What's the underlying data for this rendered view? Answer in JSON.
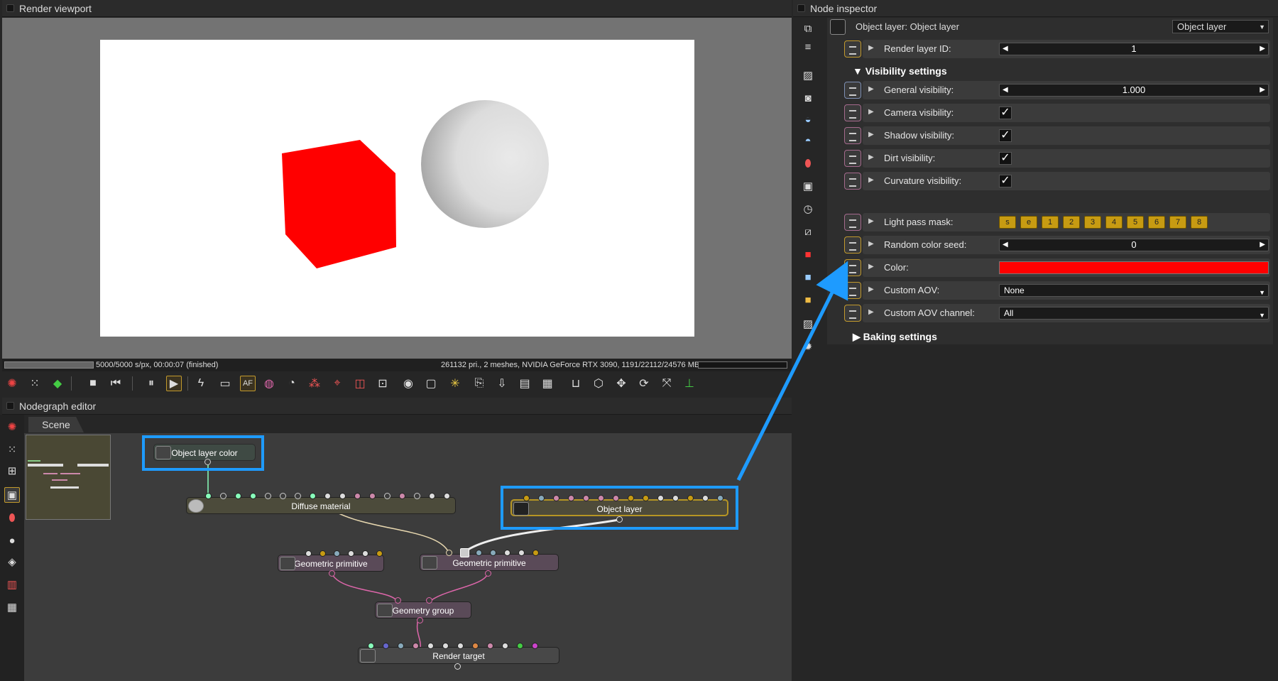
{
  "viewport": {
    "title": "Render viewport",
    "status_left": "5000/5000 s/px, 00:00:07 (finished)",
    "status_right": "261132 pri., 2 meshes, NVIDIA GeForce RTX 3090, 1191/22112/24576 MB",
    "progress": 1.0,
    "toolbar_active_label": "AF",
    "render_colors": {
      "cube": "#ff0000",
      "sphere": "#d8d8d8",
      "background": "#ffffff"
    }
  },
  "nodegraph": {
    "title": "Nodegraph editor",
    "tab": "Scene",
    "nodes": {
      "object_layer_color": "Object layer color",
      "diffuse_material": "Diffuse material",
      "object_layer": "Object layer",
      "geometric_primitive_1": "Geometric primitive",
      "geometric_primitive_2": "Geometric primitive",
      "geometry_group": "Geometry group",
      "render_target": "Render target"
    },
    "highlight_color": "#1e9bff"
  },
  "inspector": {
    "title": "Node inspector",
    "header_label": "Object layer: Object layer",
    "header_dropdown": "Object layer",
    "render_layer_id": {
      "label": "Render layer ID:",
      "value": "1"
    },
    "visibility_section": "Visibility settings",
    "general_visibility": {
      "label": "General visibility:",
      "value": "1.000"
    },
    "camera_visibility": {
      "label": "Camera visibility:",
      "checked": true
    },
    "shadow_visibility": {
      "label": "Shadow visibility:",
      "checked": true
    },
    "dirt_visibility": {
      "label": "Dirt visibility:",
      "checked": true
    },
    "curvature_visibility": {
      "label": "Curvature visibility:",
      "checked": true
    },
    "light_pass_mask": {
      "label": "Light pass mask:",
      "buttons": [
        "s",
        "e",
        "1",
        "2",
        "3",
        "4",
        "5",
        "6",
        "7",
        "8"
      ]
    },
    "random_color_seed": {
      "label": "Random color seed:",
      "value": "0"
    },
    "color": {
      "label": "Color:",
      "value": "#ff0000"
    },
    "custom_aov": {
      "label": "Custom AOV:",
      "value": "None"
    },
    "custom_aov_channel": {
      "label": "Custom AOV channel:",
      "value": "All"
    },
    "baking_section": "Baking settings",
    "check_glyph": "✓"
  }
}
